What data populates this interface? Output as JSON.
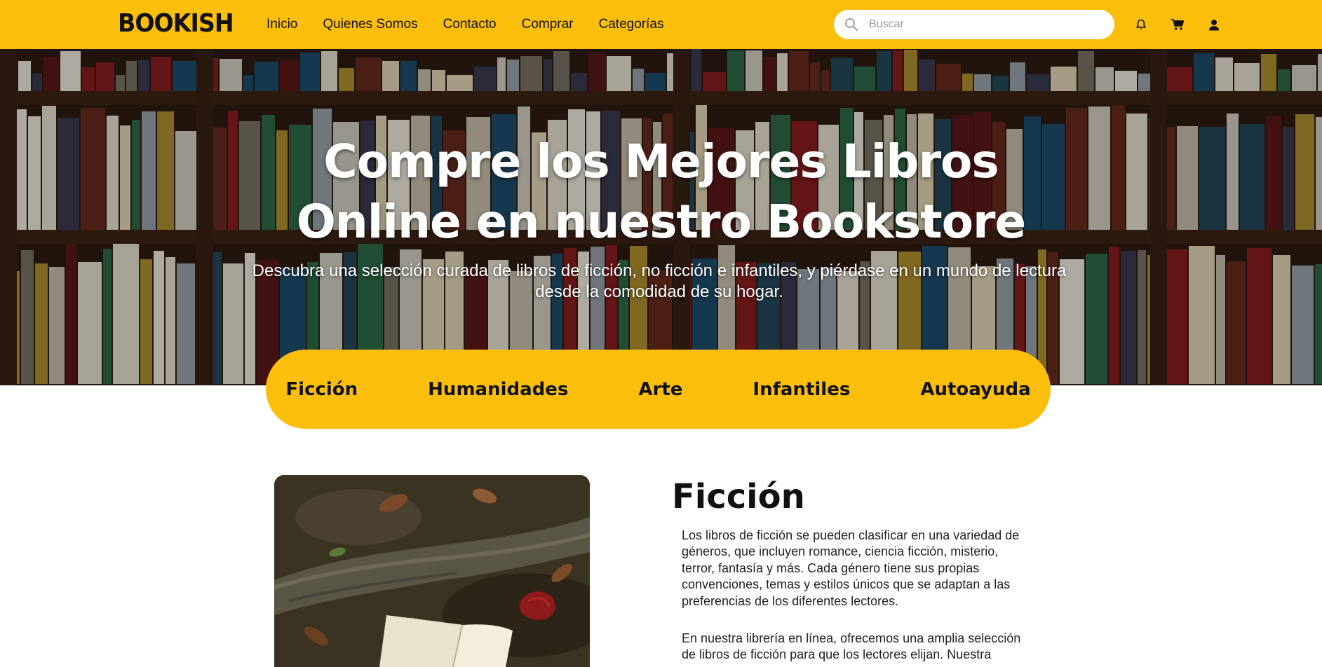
{
  "brand": {
    "logo_text": "BOOKISH"
  },
  "nav": {
    "links": [
      "Inicio",
      "Quienes Somos",
      "Contacto",
      "Comprar",
      "Categorías"
    ]
  },
  "search": {
    "placeholder": "Buscar"
  },
  "icons": {
    "search": "search-icon",
    "notifications": "bell-icon",
    "cart": "cart-icon",
    "account": "user-icon"
  },
  "colors": {
    "accent": "#fbbf0b",
    "text": "#111111",
    "hero_text": "#ffffff"
  },
  "hero": {
    "title_line1": "Compre los Mejores Libros",
    "title_line2": "Online en nuestro Bookstore",
    "subtitle": "Descubra una selección curada de libros de ficción, no ficción e infantiles, y piérdase en un mundo de lectura desde la comodidad de su hogar."
  },
  "categories": [
    "Ficción",
    "Humanidades",
    "Arte",
    "Infantiles",
    "Autoayuda"
  ],
  "section": {
    "title": "Ficción",
    "paragraphs": [
      "Los libros de ficción se pueden clasificar en una variedad de géneros, que incluyen romance, ciencia ficción, misterio, terror, fantasía y más. Cada género tiene sus propias convenciones, temas y estilos únicos que se adaptan a las preferencias de los diferentes lectores.",
      "En nuestra librería en línea, ofrecemos una amplia selección de libros de ficción para que los lectores elijan. Nuestra"
    ]
  }
}
